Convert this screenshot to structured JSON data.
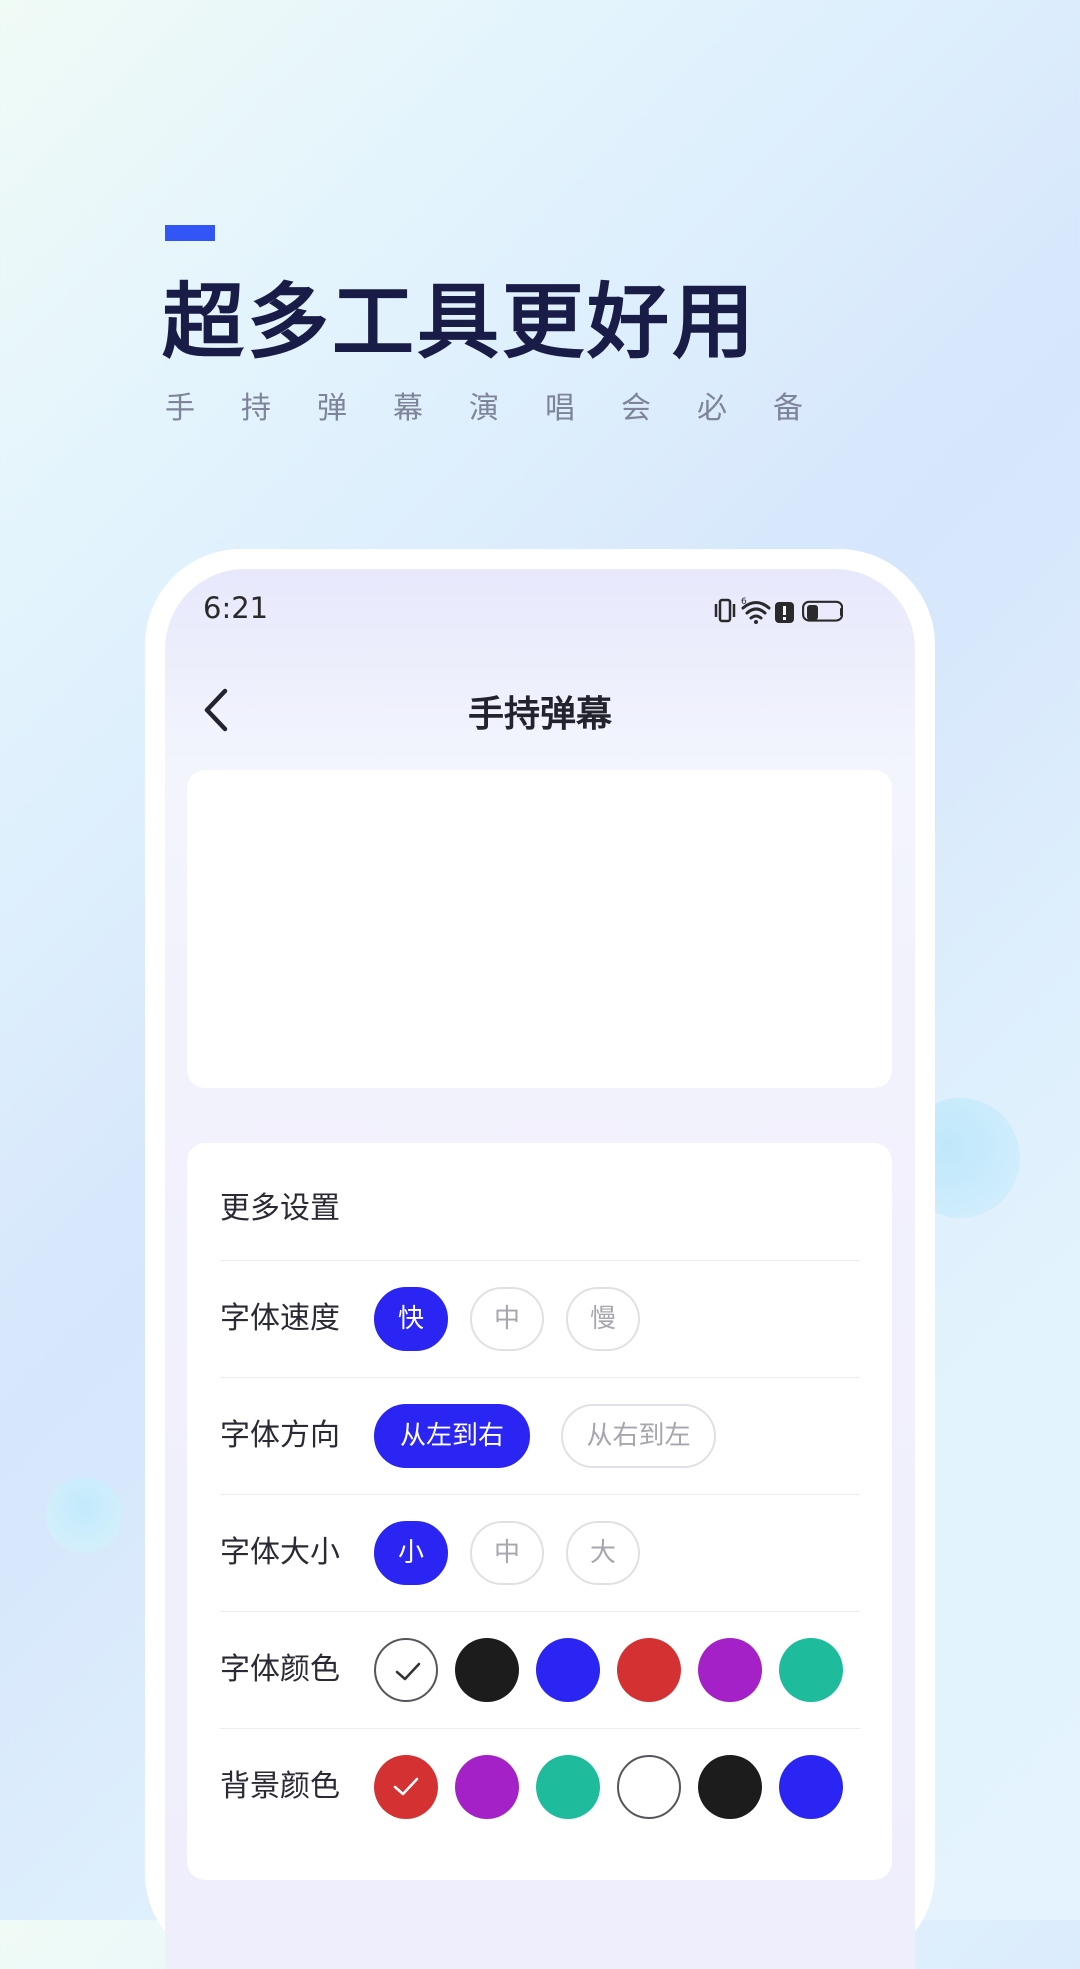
{
  "hero": {
    "title": "超多工具更好用",
    "subtitle": "手持弹幕演唱会必备",
    "accent_color": "#3255f5"
  },
  "status_bar": {
    "time": "6:21",
    "icons": [
      "vibrate-icon",
      "wifi-icon",
      "alert-icon",
      "battery-icon"
    ]
  },
  "nav": {
    "back_icon": "chevron-left-icon",
    "title": "手持弹幕"
  },
  "settings": {
    "title": "更多设置",
    "speed": {
      "label": "字体速度",
      "options": [
        "快",
        "中",
        "慢"
      ],
      "selected": "快"
    },
    "direction": {
      "label": "字体方向",
      "options": [
        "从左到右",
        "从右到左"
      ],
      "selected": "从左到右"
    },
    "size": {
      "label": "字体大小",
      "options": [
        "小",
        "中",
        "大"
      ],
      "selected": "小"
    },
    "font_color": {
      "label": "字体颜色",
      "colors": [
        "#ffffff",
        "#1c1c1c",
        "#2a25f2",
        "#d43232",
        "#a420c7",
        "#1ebc9c"
      ],
      "selected_index": 0
    },
    "bg_color": {
      "label": "背景颜色",
      "colors": [
        "#d43232",
        "#a420c7",
        "#1ebc9c",
        "#ffffff",
        "#1c1c1c",
        "#2a25f2"
      ],
      "selected_index": 0
    },
    "accent_color": "#2a25f2"
  }
}
